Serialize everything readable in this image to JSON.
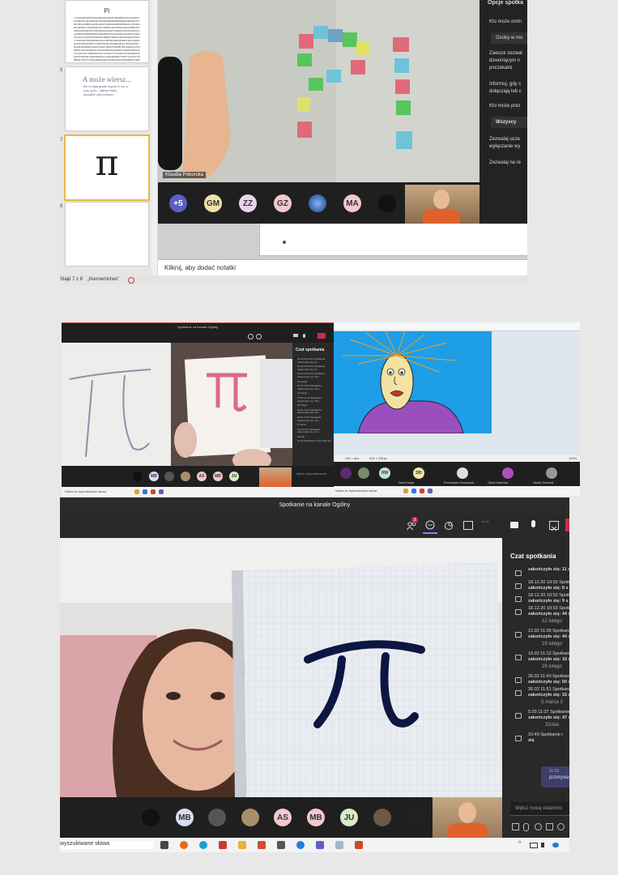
{
  "panel1": {
    "slides": [
      {
        "number": "",
        "title": "Pi",
        "body": "3.14159265358979323846264338327950288419716939937510582097494459230781640628620899862803482534211706798214808651328230664709384460955058223172535940812848111745028410270193852110555964462294895493038196442881097566593344612847564823378678316527120190914564856692346034861045432664821339360726024914127372458700660631558817488152092096282925409171536436789259036001133053054882046652138414695194151160943305727036575959195309218611738193261179310511854807446237996274956735188575272489122793818301194912983367336244065664308602139494639522473719070217986094370277053921717629317675238467481846766940513200056812714526356082778577134275778960917363717872146844090122495343014654958537105079227968925892354201995611212902196086403441815981362977477130996051870721134999999"
      },
      {
        "number": "5",
        "title": "A może wiersz...",
        "body": "Kto w mojej głowie trzyma Pi, ten w porę życia... ułamek liczby... wszystkie cyfry policzyć..."
      },
      {
        "number": "7",
        "title": "π",
        "body": ""
      },
      {
        "number": "8",
        "title": "",
        "body": ""
      }
    ],
    "status_bar": {
      "slide_indicator": "Slajd 7 z 8",
      "theme": "„Kierownictwo”"
    },
    "notes_placeholder": "Kliknij, aby dodać notatki",
    "video_name": "Klaudia Poborska",
    "video_more": "···",
    "participants": [
      {
        "label": "+5",
        "color": "#5b5fc7"
      },
      {
        "label": "GM",
        "color": "#f1e3a8"
      },
      {
        "label": "ZZ",
        "color": "#e9d3ea"
      },
      {
        "label": "GZ",
        "color": "#f2c8cf"
      },
      {
        "label": "",
        "color": "#2f5fa0"
      },
      {
        "label": "MA",
        "color": "#f2c8cf"
      },
      {
        "label": "",
        "color": "#222222"
      }
    ],
    "options": {
      "title": "Opcje spotka",
      "q1": "Kto może omin",
      "q1_value": "Osoby w mo",
      "q2_lines": [
        "Zawsze zezwal",
        "dzwoniącym n",
        "poczekalni"
      ],
      "q3_lines": [
        "Informuj, gdy c",
        "dołączają lub c"
      ],
      "q4": "Kto może prez",
      "q4_value": "Wszyscy",
      "q5_lines": [
        "Zezwalaj ucze",
        "wyłączanie wy"
      ],
      "q6": "Zezwalaj na re"
    }
  },
  "panel2": {
    "left": {
      "title": "Spotkanie na kanale Ogólny",
      "chat_title": "Czat spotkania",
      "chat_items": [
        "18.12.20 10:52 Spotkanie zakończyło się: 8 s",
        "18.12.20 10:52 Spotkanie zakończyło się: 9 s",
        "18.12.20 10:53 Spotkanie zakończyło się: 44 s",
        "12 lutego",
        "12.02 11:36 Spotkanie zakończyło się: 44 s",
        "19 lutego",
        "19.02 11:12 Spotkanie zakończyło się: 15 s",
        "26 lutego",
        "26.02 11:43 Spotkanie zakończyło się: 50 s",
        "26.02 11:51 Spotkanie zakończyło się: 15 s",
        "5 marca",
        "5.03 11:37 Spotkanie zakończyło się: 47 s",
        "Dzisiaj",
        "10:49 Spotkanie rozpoczęło się"
      ],
      "participants": [
        "MB",
        "AS",
        "MB",
        "JU"
      ],
      "search": "Wpisz tu wyszukiwane słowo",
      "compose": "Wpisz nową wiadomość"
    },
    "right": {
      "zoom": "100%",
      "status_left": "116 × 4px",
      "status_mid": "618 × 481px",
      "participants": [
        {
          "label": "RM",
          "color": "#bfe1d6"
        },
        {
          "label": "DD",
          "color": "#f1e3a8"
        }
      ],
      "names": [
        "Daria Darga",
        "Przemysław Krzyżaniak",
        "Oliwia Zalewska",
        "Maciej Sachecki"
      ],
      "search": "Wpisz tu wyszukiwane słowa"
    }
  },
  "panel3": {
    "title": "Spotkanie na kanale Ogólny",
    "badge": "3",
    "chat_title": "Czat spotkania",
    "chat_entries": [
      {
        "type": "entry",
        "time": "",
        "line1": "",
        "line2": "zakończyło się: 11 s"
      },
      {
        "type": "entry",
        "time": "18.12.20 10:52",
        "line1": "Spotkanie",
        "line2": "zakończyło się: 8 s"
      },
      {
        "type": "entry",
        "time": "18.12.20 10:52",
        "line1": "Spotkanie",
        "line2": "zakończyło się: 9 s"
      },
      {
        "type": "entry",
        "time": "18.12.20 10:53",
        "line1": "Spotkanie",
        "line2": "zakończyło się: 44 s"
      },
      {
        "type": "date",
        "text": "12 lutego"
      },
      {
        "type": "entry",
        "time": "12.02 11:36",
        "line1": "Spotkanie",
        "line2": "zakończyło się: 44 s"
      },
      {
        "type": "date",
        "text": "19 lutego"
      },
      {
        "type": "entry",
        "time": "19.02 11:12",
        "line1": "Spotkanie",
        "line2": "zakończyło się: 15 s"
      },
      {
        "type": "date",
        "text": "26 lutego"
      },
      {
        "type": "entry",
        "time": "26.02 11:43",
        "line1": "Spotkanie",
        "line2": "zakończyło się: 50 s"
      },
      {
        "type": "entry",
        "time": "26.02 11:51",
        "line1": "Spotkanie",
        "line2": "zakończyło się: 15 s"
      },
      {
        "type": "date",
        "text": "5 marca 2"
      },
      {
        "type": "entry",
        "time": "5.03 11:37",
        "line1": "Spotkanie",
        "line2": "zakończyło się: 47 s"
      },
      {
        "type": "date",
        "text": "Dzisia"
      },
      {
        "type": "entry",
        "time": "10:49",
        "line1": "Spotkanie r",
        "line2": "się"
      }
    ],
    "msg_time": "11:03",
    "msg_text": "przerywa",
    "compose": "Wpisz nową wiadomo",
    "participants": [
      {
        "label": "",
        "color": "#111111"
      },
      {
        "label": "MB",
        "color": "#d9dcf4"
      },
      {
        "label": "",
        "color": "#555555"
      },
      {
        "label": "",
        "color": "#a58f6a"
      },
      {
        "label": "AS",
        "color": "#f2c8cf"
      },
      {
        "label": "MB",
        "color": "#f2c8cf"
      },
      {
        "label": "JU",
        "color": "#d8ecc4"
      },
      {
        "label": "",
        "color": "#6b5a4a"
      },
      {
        "label": "",
        "color": "#222222"
      }
    ],
    "search": "wyszukiwane słowa"
  }
}
